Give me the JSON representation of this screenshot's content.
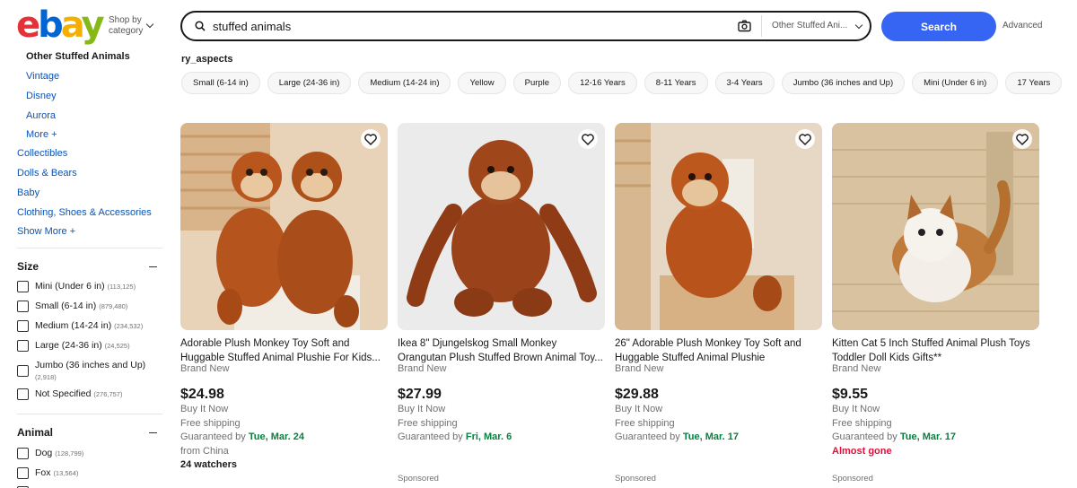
{
  "header": {
    "logo": {
      "e": "e",
      "b": "b",
      "a": "a",
      "y": "y"
    },
    "shop_by_line1": "Shop by",
    "shop_by_line2": "category",
    "search_value": "stuffed animals",
    "category_select": "Other Stuffed Ani...",
    "search_button": "Search",
    "advanced": "Advanced"
  },
  "sidebar": {
    "current": "Other Stuffed Animals",
    "subcats": [
      "Vintage",
      "Disney",
      "Aurora",
      "More +"
    ],
    "cats": [
      "Collectibles",
      "Dolls & Bears",
      "Baby",
      "Clothing, Shoes & Accessories",
      "Show More +"
    ],
    "size": {
      "heading": "Size",
      "options": [
        {
          "label": "Mini (Under 6 in)",
          "count": "(113,125)"
        },
        {
          "label": "Small (6-14 in)",
          "count": "(879,480)"
        },
        {
          "label": "Medium (14-24 in)",
          "count": "(234,532)"
        },
        {
          "label": "Large (24-36 in)",
          "count": "(24,525)"
        },
        {
          "label": "Jumbo (36 inches and Up)",
          "count": "(2,918)"
        },
        {
          "label": "Not Specified",
          "count": "(276,757)"
        }
      ]
    },
    "animal": {
      "heading": "Animal",
      "options": [
        {
          "label": "Dog",
          "count": "(128,799)"
        },
        {
          "label": "Fox",
          "count": "(13,564)"
        }
      ]
    }
  },
  "aspects": {
    "title": "ry_aspects",
    "chips": [
      "Small (6-14 in)",
      "Large (24-36 in)",
      "Medium (14-24 in)",
      "Yellow",
      "Purple",
      "12-16 Years",
      "8-11 Years",
      "3-4 Years",
      "Jumbo (36 inches and Up)",
      "Mini (Under 6 in)",
      "17 Years"
    ]
  },
  "listings": [
    {
      "title": "Adorable Plush Monkey Toy Soft and Huggable Stuffed Animal Plushie For Kids...",
      "condition": "Brand New",
      "price": "$24.98",
      "format": "Buy It Now",
      "shipping": "Free shipping",
      "guaranteed_prefix": "Guaranteed by",
      "guaranteed_date": "Tue, Mar. 24",
      "origin": "from China",
      "watchers": "24 watchers",
      "status": "",
      "sponsored": ""
    },
    {
      "title": "Ikea 8\" Djungelskog Small Monkey Orangutan Plush Stuffed Brown Animal Toy...",
      "condition": "Brand New",
      "price": "$27.99",
      "format": "Buy It Now",
      "shipping": "Free shipping",
      "guaranteed_prefix": "Guaranteed by",
      "guaranteed_date": "Fri, Mar. 6",
      "origin": "",
      "watchers": "",
      "status": "",
      "sponsored": "Sponsored"
    },
    {
      "title": "26\" Adorable Plush Monkey Toy Soft and Huggable Stuffed Animal Plushie",
      "condition": "Brand New",
      "price": "$29.88",
      "format": "Buy It Now",
      "shipping": "Free shipping",
      "guaranteed_prefix": "Guaranteed by",
      "guaranteed_date": "Tue, Mar. 17",
      "origin": "",
      "watchers": "",
      "status": "",
      "sponsored": "Sponsored"
    },
    {
      "title": "Kitten Cat 5 Inch Stuffed Animal Plush Toys Toddler Doll Kids Gifts**",
      "condition": "Brand New",
      "price": "$9.55",
      "format": "Buy It Now",
      "shipping": "Free shipping",
      "guaranteed_prefix": "Guaranteed by",
      "guaranteed_date": "Tue, Mar. 17",
      "origin": "",
      "watchers": "",
      "status": "Almost gone",
      "sponsored": "Sponsored"
    }
  ],
  "colors": {
    "accent": "#3665f3",
    "link": "#0654ba",
    "delivery_green": "#05823f",
    "alert_red": "#e0103a"
  }
}
